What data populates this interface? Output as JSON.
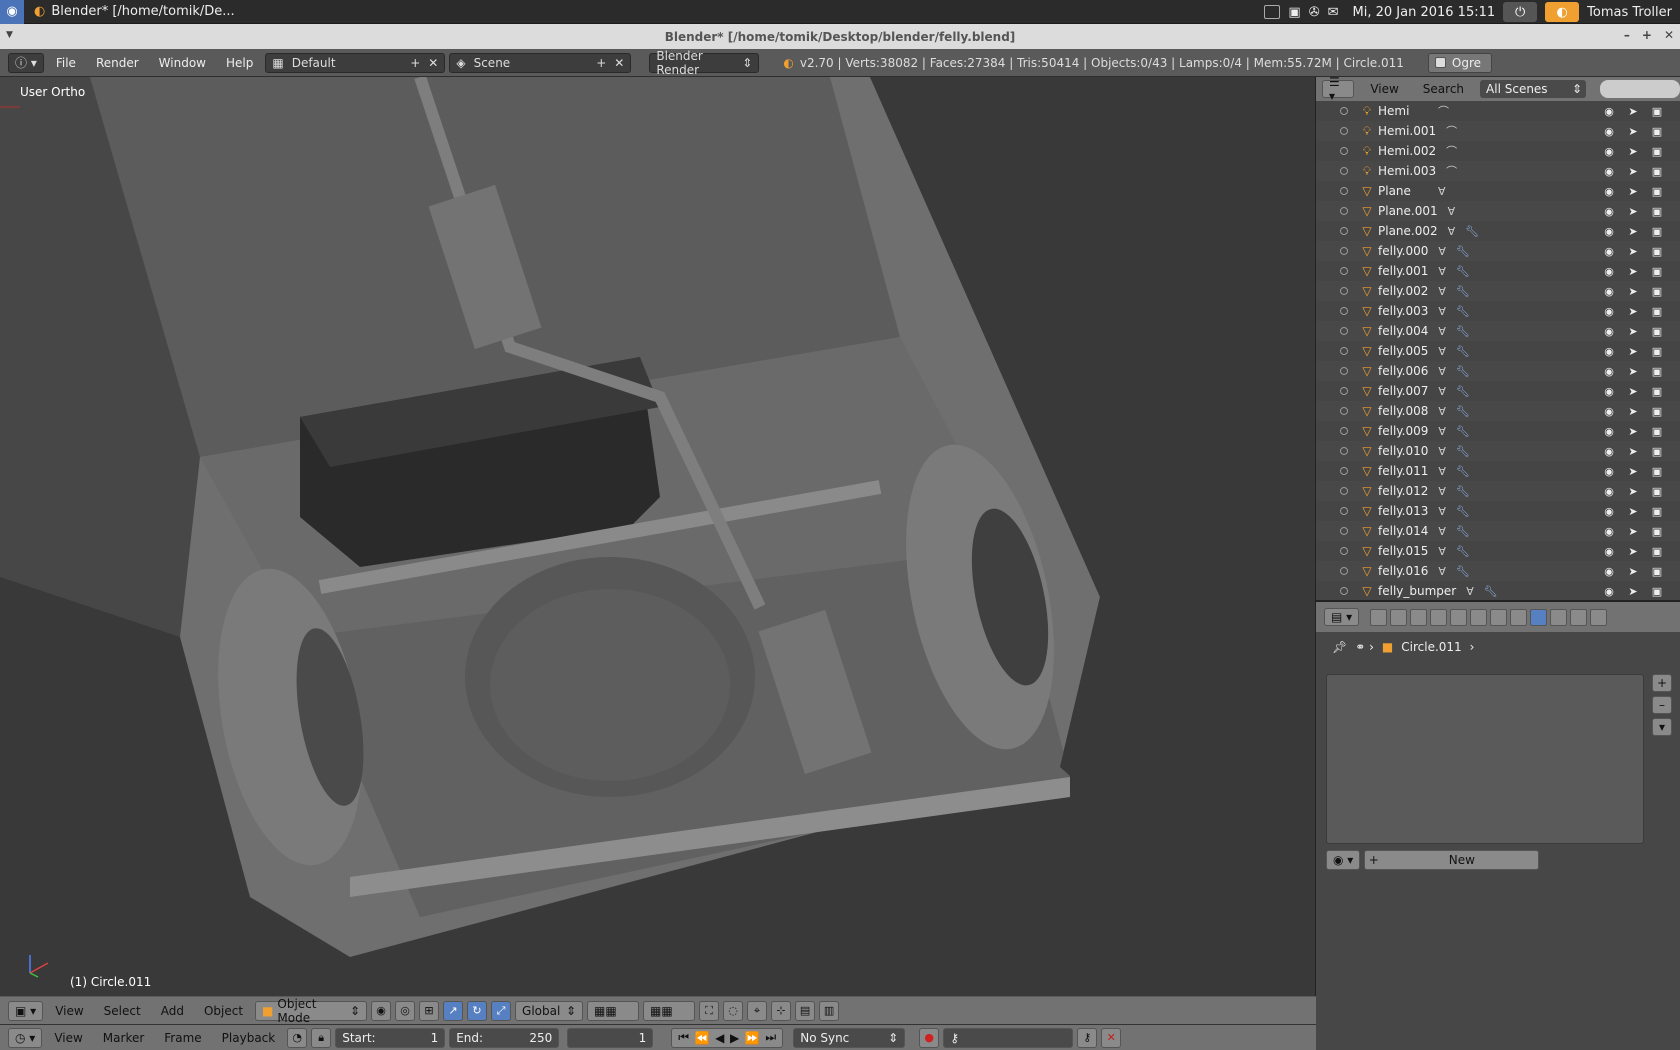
{
  "system": {
    "app_title": "Blender* [/home/tomik/De...",
    "datetime": "Mi, 20 Jan 2016 15:11",
    "user": "Tomas Troller"
  },
  "window": {
    "title": "Blender* [/home/tomik/Desktop/blender/felly.blend]"
  },
  "info": {
    "menus": [
      "File",
      "Render",
      "Window",
      "Help"
    ],
    "layout": "Default",
    "scene": "Scene",
    "engine": "Blender Render",
    "stats": "v2.70 | Verts:38082 | Faces:27384 | Tris:50414 | Objects:0/43 | Lamps:0/4 | Mem:55.72M | Circle.011",
    "ogre": "Ogre"
  },
  "viewport": {
    "view_label": "User Ortho",
    "object_label": "(1) Circle.011"
  },
  "view3d_header": {
    "menus": [
      "View",
      "Select",
      "Add",
      "Object"
    ],
    "mode": "Object Mode",
    "orientation": "Global"
  },
  "timeline": {
    "menus": [
      "View",
      "Marker",
      "Frame",
      "Playback"
    ],
    "start_label": "Start:",
    "start_value": "1",
    "end_label": "End:",
    "end_value": "250",
    "current_frame": "1",
    "sync": "No Sync"
  },
  "outliner": {
    "menus": [
      "View",
      "Search"
    ],
    "filter": "All Scenes",
    "items": [
      {
        "name": "Hemi",
        "type": "lamp",
        "data": "lamp"
      },
      {
        "name": "Hemi.001",
        "type": "lamp",
        "data": "lamp"
      },
      {
        "name": "Hemi.002",
        "type": "lamp",
        "data": "lamp"
      },
      {
        "name": "Hemi.003",
        "type": "lamp",
        "data": "lamp"
      },
      {
        "name": "Plane",
        "type": "mesh",
        "data": "mesh"
      },
      {
        "name": "Plane.001",
        "type": "mesh",
        "data": "mesh"
      },
      {
        "name": "Plane.002",
        "type": "mesh",
        "data": "mesh+modifier"
      },
      {
        "name": "felly.000",
        "type": "mesh",
        "data": "mesh+modifier"
      },
      {
        "name": "felly.001",
        "type": "mesh",
        "data": "mesh+modifier"
      },
      {
        "name": "felly.002",
        "type": "mesh",
        "data": "mesh+modifier"
      },
      {
        "name": "felly.003",
        "type": "mesh",
        "data": "mesh+modifier"
      },
      {
        "name": "felly.004",
        "type": "mesh",
        "data": "mesh+modifier"
      },
      {
        "name": "felly.005",
        "type": "mesh",
        "data": "mesh+modifier"
      },
      {
        "name": "felly.006",
        "type": "mesh",
        "data": "mesh+modifier"
      },
      {
        "name": "felly.007",
        "type": "mesh",
        "data": "mesh+modifier"
      },
      {
        "name": "felly.008",
        "type": "mesh",
        "data": "mesh+modifier"
      },
      {
        "name": "felly.009",
        "type": "mesh",
        "data": "mesh+modifier"
      },
      {
        "name": "felly.010",
        "type": "mesh",
        "data": "mesh+modifier"
      },
      {
        "name": "felly.011",
        "type": "mesh",
        "data": "mesh+modifier"
      },
      {
        "name": "felly.012",
        "type": "mesh",
        "data": "mesh+modifier"
      },
      {
        "name": "felly.013",
        "type": "mesh",
        "data": "mesh+modifier"
      },
      {
        "name": "felly.014",
        "type": "mesh",
        "data": "mesh+modifier"
      },
      {
        "name": "felly.015",
        "type": "mesh",
        "data": "mesh+modifier"
      },
      {
        "name": "felly.016",
        "type": "mesh",
        "data": "mesh+modifier"
      },
      {
        "name": "felly_bumper",
        "type": "mesh",
        "data": "mesh+modifier"
      }
    ]
  },
  "properties": {
    "breadcrumb": "Circle.011",
    "new_label": "New"
  },
  "colors": {
    "accent": "#5680c2",
    "object_icon": "#f0a030",
    "viewport_bg": "#393939"
  }
}
